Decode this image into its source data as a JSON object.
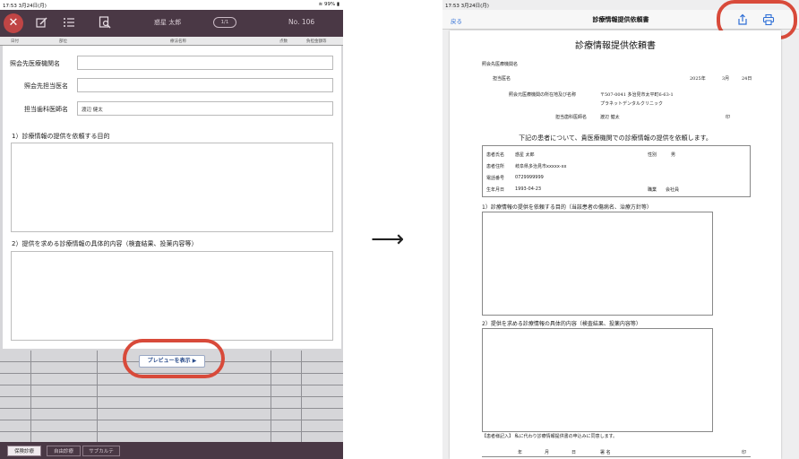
{
  "left_screen": {
    "status_time": "17:53",
    "status_date": "3月24日(月)",
    "status_battery": "99%",
    "topbar": {
      "patient_name": "惑星 太郎",
      "pager": "1/1",
      "record_no": "No. 106"
    },
    "table_headers": [
      "日付",
      "部位",
      "療法名称",
      "点数",
      "負担金額等"
    ],
    "form": {
      "institution_label": "照会先医療機関名",
      "institution_value": "",
      "doctor_label": "照会先担当医名",
      "doctor_value": "",
      "dentist_label": "担当歯科医師名",
      "dentist_value": "渡辺 健太",
      "section1_title": "1）診療情報の提供を依頼する目的",
      "section2_title": "2）提供を求める診療情報の具体的内容（検査結果、投薬内容等）",
      "preview_button": "プレビューを表示 ▶"
    },
    "bottom_tabs": [
      "保険診療",
      "自由診療",
      "サブカルテ"
    ]
  },
  "arrow": "⟶",
  "right_screen": {
    "status_time": "17:53",
    "status_date": "3月24日(月)",
    "nav": {
      "back_label": "戻る",
      "title": "診療情報提供依頼書"
    },
    "document": {
      "title": "診療情報提供依頼書",
      "institution_label": "照会先医療機関名",
      "doctor_label": "担当医名",
      "date_year": "2025年",
      "date_month": "3月",
      "date_day": "24日",
      "address_label": "照会元医療機関の所在地及び名称",
      "address_value": "〒507-0041 多治見市太平町6-63-1",
      "clinic_name": "プラネットデンタルクリニック",
      "dentist_label": "担当歯科医師名",
      "dentist_value": "渡辺 健太",
      "seal_mark": "印",
      "lead_text": "下記の患者について、貴医療機関での診療情報の提供を依頼します。",
      "patient": {
        "name_label": "患者氏名",
        "name_value": "惑星 太郎",
        "sex_label": "性別",
        "sex_value": "男",
        "address_label": "患者住所",
        "address_value": "岐阜県多治見市xxxxx-xx",
        "phone_label": "電話番号",
        "phone_value": "0729999999",
        "birth_label": "生年月日",
        "birth_value": "1993-04-23",
        "job_label": "職業",
        "job_value": "会社員"
      },
      "section1_title": "1）診療情報の提供を依頼する目的（当該患者の傷病名、治療方針等）",
      "section2_title": "2）提供を求める診療情報の具体的内容（検査結果、投薬内容等）",
      "consent_text": "【患者様記入】 私に代わり診療情報提供書の申込みに同意します。",
      "sign_year": "年",
      "sign_month": "月",
      "sign_day": "日",
      "sign_label": "署 名",
      "sign_seal": "印"
    }
  },
  "colors": {
    "topbar": "#4a3845",
    "highlight": "#d84a3a",
    "link_blue": "#2f6fd6",
    "close_red": "#c04545"
  },
  "icons": [
    "close-icon",
    "edit-icon",
    "list-icon",
    "document-search-icon",
    "share-icon",
    "print-icon",
    "wifi-icon",
    "battery-icon"
  ]
}
